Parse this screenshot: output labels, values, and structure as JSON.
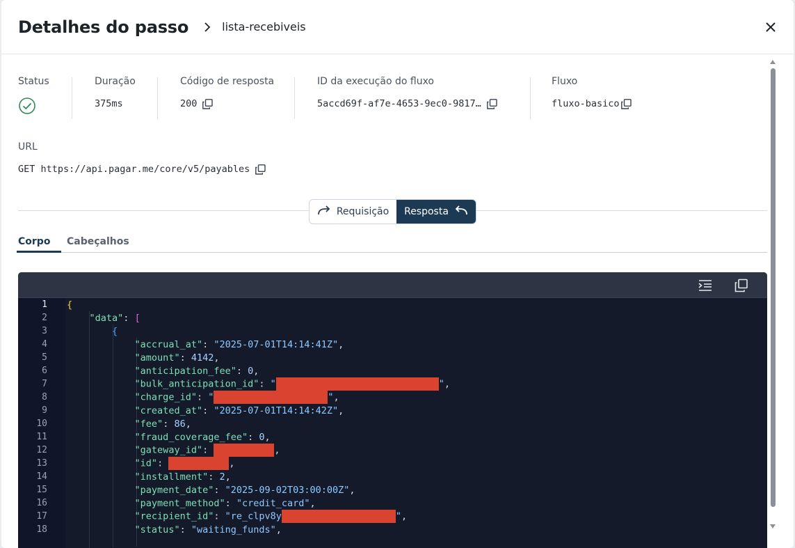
{
  "header": {
    "title": "Detalhes do passo",
    "breadcrumb": "lista-recebiveis"
  },
  "meta": {
    "status_label": "Status",
    "duration_label": "Duração",
    "duration_value": "375ms",
    "code_label": "Código de resposta",
    "code_value": "200",
    "execution_label": "ID da execução do fluxo",
    "execution_value": "5accd69f-af7e-4653-9ec0-9817…",
    "flow_label": "Fluxo",
    "flow_value": "fluxo-basico"
  },
  "url": {
    "label": "URL",
    "value": "GET https://api.pagar.me/core/v5/payables"
  },
  "toggle": {
    "request_label": "Requisição",
    "response_label": "Resposta"
  },
  "tabs": {
    "body": "Corpo",
    "headers": "Cabeçalhos"
  },
  "editor": {
    "line_numbers": [
      "1",
      "2",
      "3",
      "4",
      "5",
      "6",
      "7",
      "8",
      "9",
      "10",
      "11",
      "12",
      "13",
      "14",
      "15",
      "16",
      "17",
      "18"
    ],
    "keys": {
      "data": "\"data\"",
      "accrual_at": "\"accrual_at\"",
      "amount": "\"amount\"",
      "anticipation_fee": "\"anticipation_fee\"",
      "bulk_anticipation_id": "\"bulk_anticipation_id\"",
      "charge_id": "\"charge_id\"",
      "created_at": "\"created_at\"",
      "fee": "\"fee\"",
      "fraud_coverage_fee": "\"fraud_coverage_fee\"",
      "gateway_id": "\"gateway_id\"",
      "id": "\"id\"",
      "installment": "\"installment\"",
      "payment_date": "\"payment_date\"",
      "payment_method": "\"payment_method\"",
      "recipient_id": "\"recipient_id\"",
      "status": "\"status\""
    },
    "values": {
      "accrual_at": "\"2025-07-01T14:14:41Z\"",
      "amount": "4142",
      "anticipation_fee": "0",
      "created_at": "\"2025-07-01T14:14:42Z\"",
      "fee": "86",
      "fraud_coverage_fee": "0",
      "installment": "2",
      "payment_date": "\"2025-09-02T03:00:00Z\"",
      "payment_method": "\"credit_card\"",
      "recipient_id_prefix": "\"re_clpv8y",
      "status": "\"waiting_funds\""
    }
  }
}
